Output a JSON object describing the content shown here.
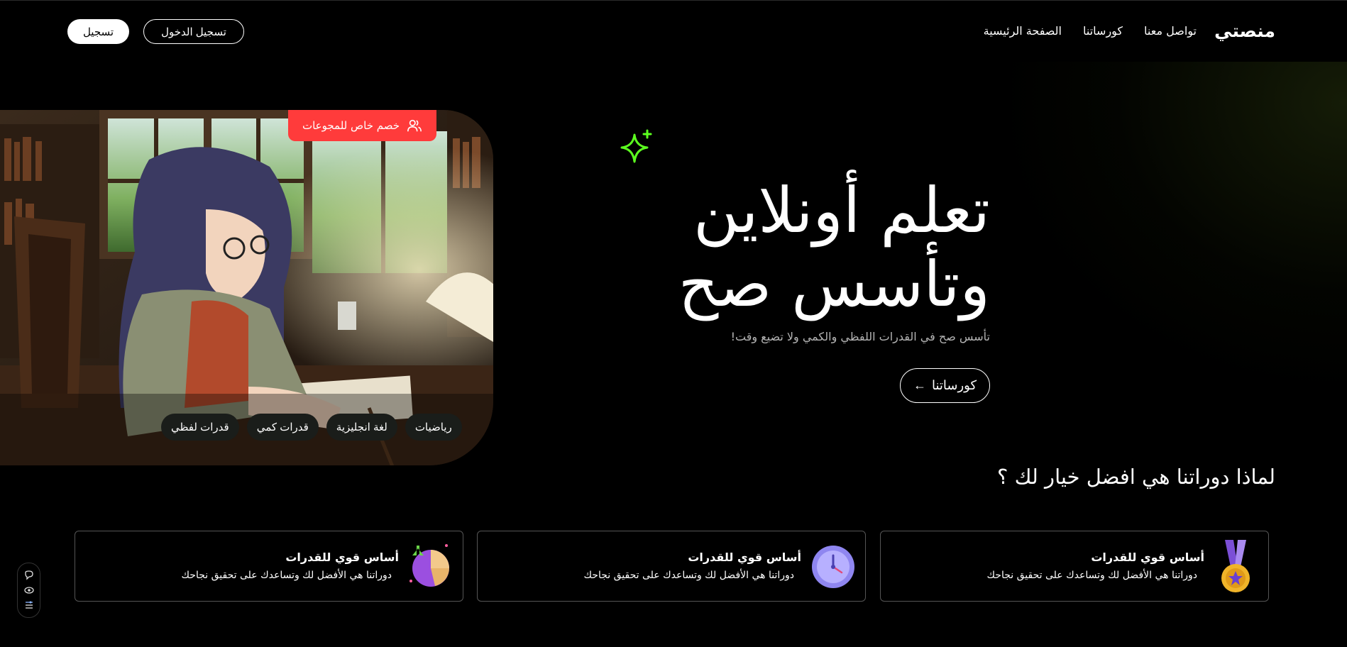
{
  "header": {
    "brand": "منصتي",
    "nav": [
      "الصفحة الرئيسية",
      "كورساتنا",
      "تواصل معنا"
    ],
    "login_label": "تسجيل الدخول",
    "signup_label": "تسجيل"
  },
  "hero": {
    "promo_badge": "خصم خاص للمجوعات",
    "chips": [
      "قدرات لفظي",
      "قدرات كمي",
      "لغة انجليزية",
      "رياضيات"
    ],
    "headline_line1": "تعلم أونلاين",
    "headline_line2": "وتأسس صح",
    "subline": "تأسس صح في القدرات اللفظي والكمي ولا تضيع وقت!",
    "cta_label": "كورساتنا",
    "cta_arrow": "←"
  },
  "why": {
    "title": "لماذا دوراتنا هي افضل خيار لك ؟",
    "cards": [
      {
        "icon": "medal-icon",
        "title": "أساس قوي للقدرات",
        "desc": "دوراتنا هي الأفضل لك وتساعدك على تحقيق نجاحك"
      },
      {
        "icon": "clock-icon",
        "title": "أساس قوي للقدرات",
        "desc": "دوراتنا هي الأفضل لك وتساعدك على تحقيق نجاحك"
      },
      {
        "icon": "pie-chart-icon",
        "title": "أساس قوي للقدرات",
        "desc": "دوراتنا هي الأفضل لك وتساعدك على تحقيق نجاحك"
      }
    ]
  },
  "colors": {
    "accent_green": "#5cff1f",
    "badge_red": "#ff3b3b",
    "background": "#000000"
  }
}
